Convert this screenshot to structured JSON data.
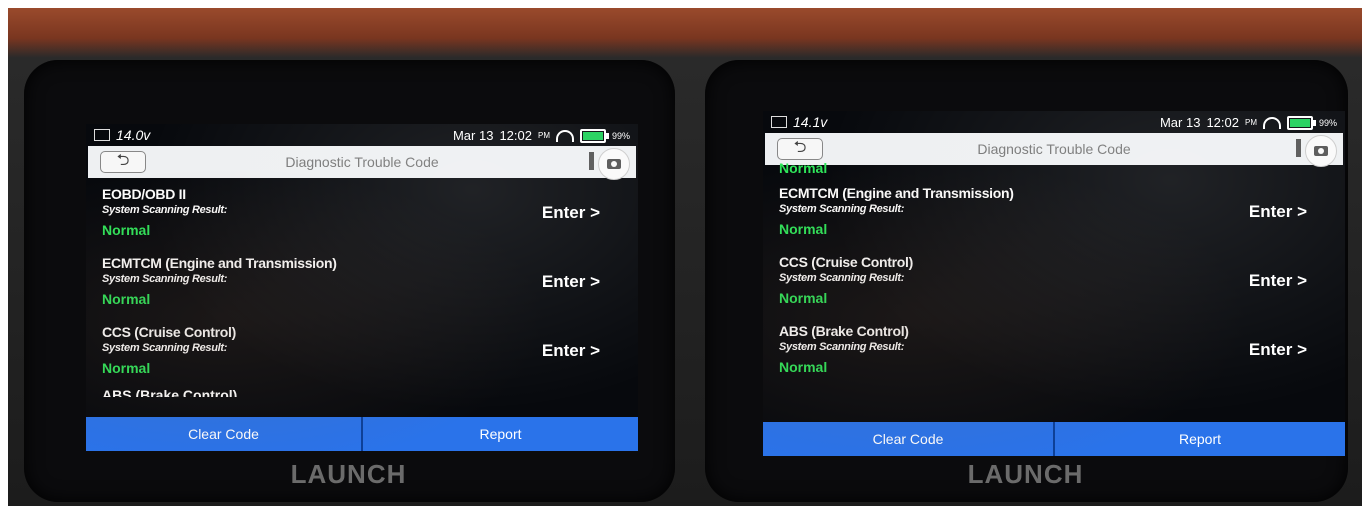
{
  "panels": [
    {
      "voltage": "14.0v",
      "date": "Mar 13",
      "time": "12:02",
      "ampm": "PM",
      "battery": "99%",
      "title": "Diagnostic Trouble Code",
      "lead_status": "",
      "items": [
        {
          "name": "EOBD/OBD II",
          "label": "System Scanning Result:",
          "status": "Normal",
          "enter": "Enter >"
        },
        {
          "name": "ECMTCM (Engine and Transmission)",
          "label": "System Scanning Result:",
          "status": "Normal",
          "enter": "Enter >"
        },
        {
          "name": "CCS (Cruise Control)",
          "label": "System Scanning Result:",
          "status": "Normal",
          "enter": "Enter >"
        }
      ],
      "cutoff_item": "ABS (Brake Control)",
      "buttons": {
        "clear": "Clear Code",
        "report": "Report"
      },
      "brand": "LAUNCH"
    },
    {
      "voltage": "14.1v",
      "date": "Mar 13",
      "time": "12:02",
      "ampm": "PM",
      "battery": "99%",
      "title": "Diagnostic Trouble Code",
      "lead_status": "Normal",
      "items": [
        {
          "name": "ECMTCM (Engine and Transmission)",
          "label": "System Scanning Result:",
          "status": "Normal",
          "enter": "Enter >"
        },
        {
          "name": "CCS (Cruise Control)",
          "label": "System Scanning Result:",
          "status": "Normal",
          "enter": "Enter >"
        },
        {
          "name": "ABS (Brake Control)",
          "label": "System Scanning Result:",
          "status": "Normal",
          "enter": "Enter >"
        }
      ],
      "cutoff_item": "",
      "buttons": {
        "clear": "Clear Code",
        "report": "Report"
      },
      "brand": "LAUNCH"
    }
  ],
  "colors": {
    "status_green": "#2ee65a",
    "button_blue": "#2a73ea"
  },
  "icons": {
    "back": "back-arrow-icon",
    "camera": "camera-icon",
    "wifi": "wifi-icon",
    "battery": "battery-icon"
  }
}
